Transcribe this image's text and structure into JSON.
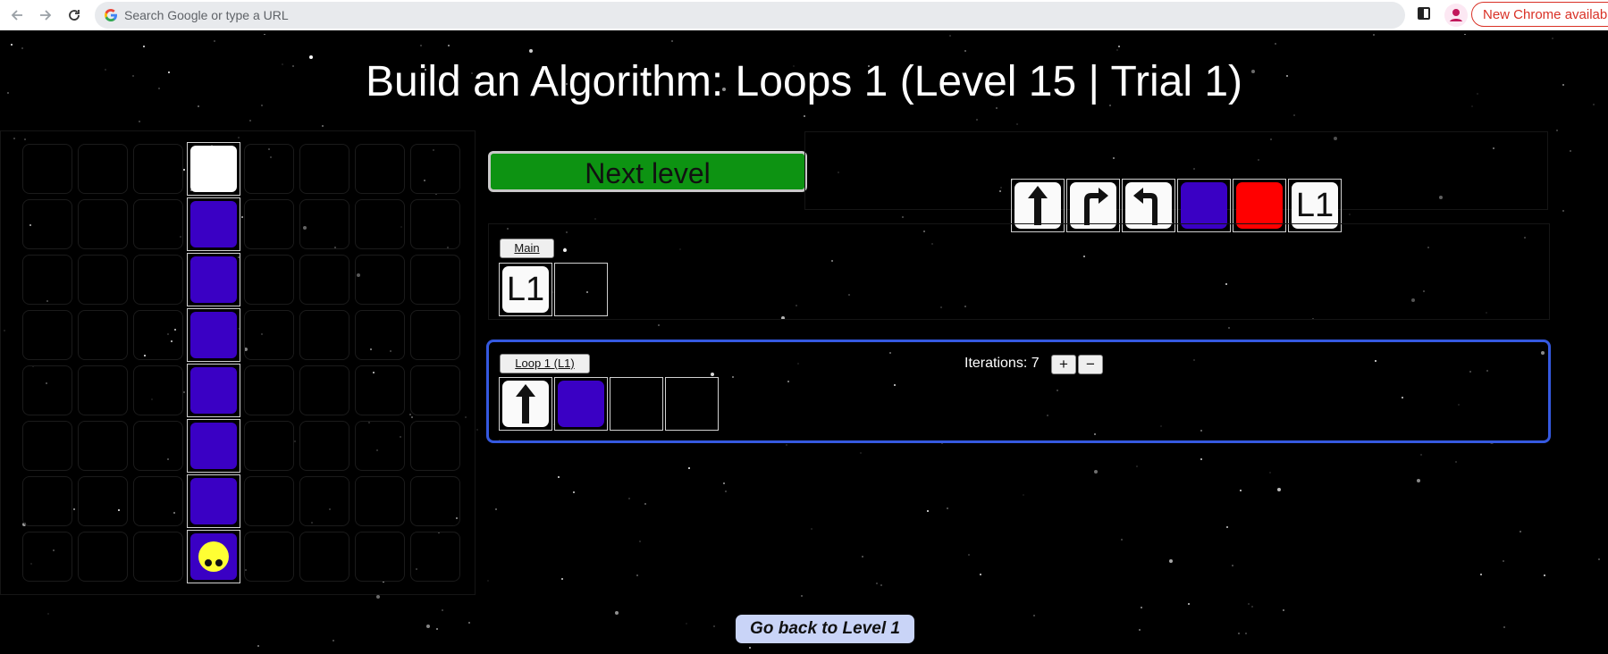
{
  "browser": {
    "back_icon": "arrow-left-icon",
    "forward_icon": "arrow-right-icon",
    "reload_icon": "reload-icon",
    "omnibox_placeholder": "Search Google or type a URL",
    "update_label": "New Chrome available"
  },
  "page": {
    "title": "Build an Algorithm: Loops 1 (Level 15 | Trial 1)",
    "next_level_label": "Next level",
    "go_back_label": "Go back to Level 1",
    "background_color": "#000000"
  },
  "board": {
    "columns": 8,
    "rows": 8,
    "path_column": 3,
    "cells": [
      {
        "row": 0,
        "kind": "goal",
        "color": "#ffffff"
      },
      {
        "row": 1,
        "kind": "painted",
        "color": "#3a00c4"
      },
      {
        "row": 2,
        "kind": "painted",
        "color": "#3a00c4"
      },
      {
        "row": 3,
        "kind": "painted",
        "color": "#3a00c4"
      },
      {
        "row": 4,
        "kind": "painted",
        "color": "#3a00c4"
      },
      {
        "row": 5,
        "kind": "painted",
        "color": "#3a00c4"
      },
      {
        "row": 6,
        "kind": "painted",
        "color": "#3a00c4"
      },
      {
        "row": 7,
        "kind": "robot",
        "color": "#3a00c4",
        "robot_color": "#ffff33"
      }
    ]
  },
  "palette": {
    "tiles": [
      {
        "name": "forward",
        "icon": "arrow-up-icon"
      },
      {
        "name": "turn-right",
        "icon": "turn-right-icon"
      },
      {
        "name": "turn-left",
        "icon": "turn-left-icon"
      },
      {
        "name": "paint-blue",
        "color": "#3a00c4"
      },
      {
        "name": "paint-red",
        "color": "#ff0000"
      },
      {
        "name": "loop-1",
        "label": "L1"
      }
    ]
  },
  "main": {
    "label": "Main",
    "slots": [
      {
        "label": "L1"
      }
    ]
  },
  "loop": {
    "label": "Loop 1 (L1)",
    "iterations_label": "Iterations: 7",
    "plus_label": "+",
    "minus_label": "−",
    "slots": [
      {
        "icon": "arrow-up-icon"
      },
      {
        "color": "#3a00c4"
      }
    ]
  },
  "colors": {
    "accent_green": "#0d9312",
    "loop_border": "#3559e0",
    "paint_blue": "#3a00c4",
    "paint_red": "#ff0000",
    "robot_yellow": "#ffff33",
    "go_back_bg": "#c9d4f7"
  }
}
